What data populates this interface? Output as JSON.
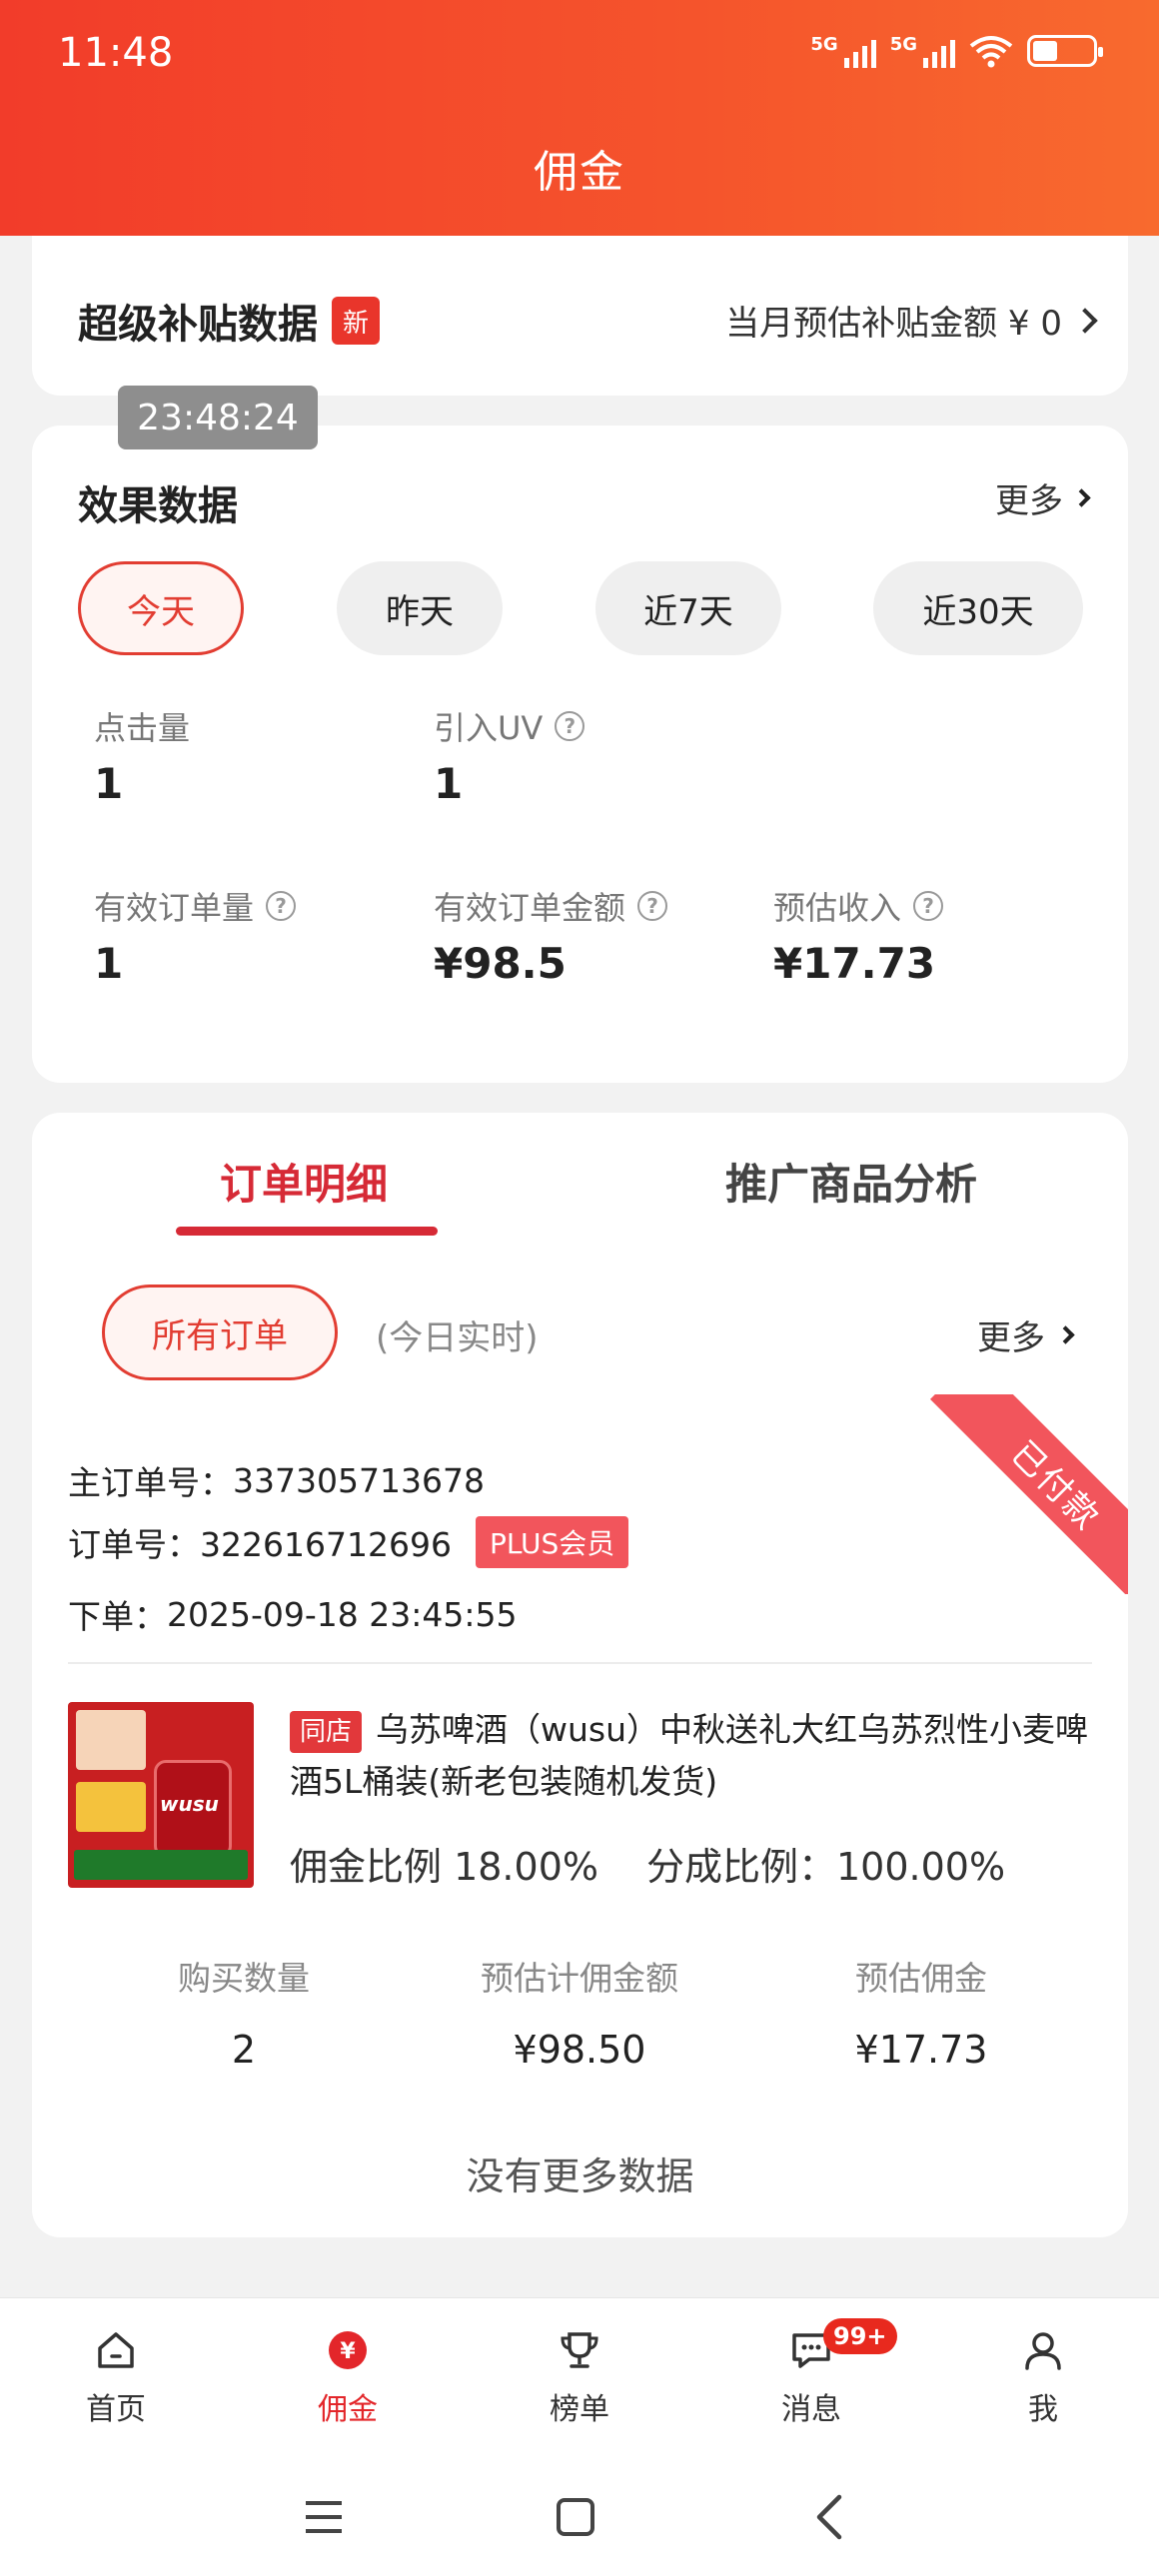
{
  "status": {
    "time": "11:48",
    "signal1": "5G",
    "signal2": "5G"
  },
  "header": {
    "title": "佣金"
  },
  "subsidy": {
    "title": "超级补贴数据",
    "new_badge": "新",
    "amount_text": "当月预估补贴金额 ¥ 0"
  },
  "toast": {
    "time": "23:48:24"
  },
  "effect": {
    "title": "效果数据",
    "more": "更多",
    "periods": [
      "今天",
      "昨天",
      "近7天",
      "近30天"
    ],
    "metrics": {
      "clicks_label": "点击量",
      "clicks_value": "1",
      "uv_label": "引入UV",
      "uv_value": "1",
      "orders_label": "有效订单量",
      "orders_value": "1",
      "amount_label": "有效订单金额",
      "amount_value": "¥98.5",
      "income_label": "预估收入",
      "income_value": "¥17.73"
    }
  },
  "orders": {
    "tabs": [
      "订单明细",
      "推广商品分析"
    ],
    "filter": "所有订单",
    "filter_sub": "(今日实时)",
    "more": "更多",
    "status_ribbon": "已付款",
    "main_order_label": "主订单号：",
    "main_order_no": "337305713678",
    "order_label": "订单号：",
    "order_no": "322616712696",
    "plus_badge": "PLUS会员",
    "placed_label": "下单：",
    "placed_time": "2025-09-18 23:45:55",
    "product": {
      "store_badge": "同店",
      "title": "乌苏啤酒（wusu）中秋送礼大红乌苏烈性小麦啤酒5L桶装(新老包装随机发货)",
      "image_text": "wusu",
      "commission_rate": "佣金比例 18.00%",
      "share_rate": "分成比例：100.00%"
    },
    "stats": {
      "qty_label": "购买数量",
      "qty_value": "2",
      "base_label": "预估计佣金额",
      "base_value": "¥98.50",
      "commission_label": "预估佣金",
      "commission_value": "¥17.73"
    },
    "no_more": "没有更多数据"
  },
  "nav": {
    "items": [
      "首页",
      "佣金",
      "榜单",
      "消息",
      "我"
    ],
    "message_badge": "99+",
    "active_index": 1
  },
  "colors": {
    "accent": "#e23d32",
    "header_start": "#f23c2a",
    "header_end": "#f86a2e",
    "ribbon": "#f2555c"
  }
}
